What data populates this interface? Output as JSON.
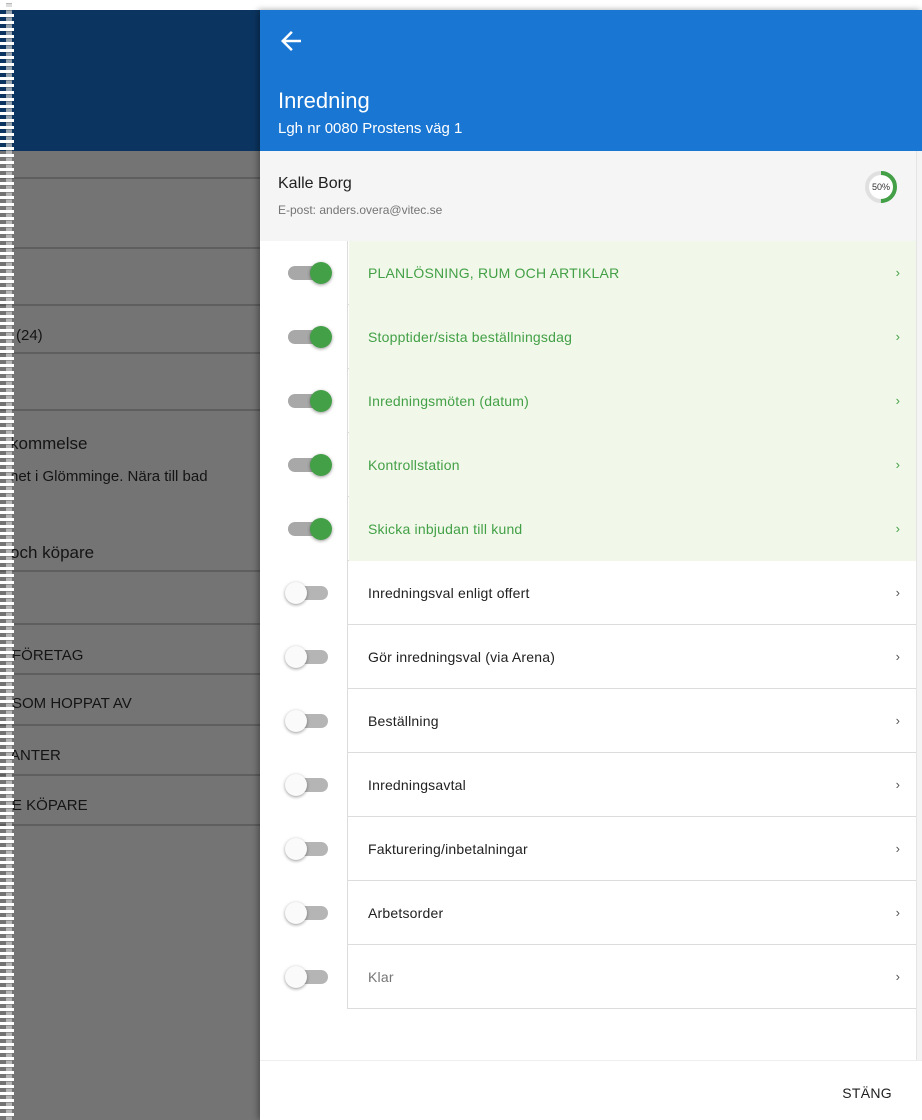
{
  "background": {
    "rows": [
      "(24)",
      "kommelse",
      "net i Glömminge. Nära till bad",
      "och köpare",
      "FÖRETAG",
      "SOM HOPPAT AV",
      "ANTER",
      "E KÖPARE"
    ]
  },
  "panel": {
    "title": "Inredning",
    "subtitle": "Lgh nr 0080 Prostens väg 1",
    "back_icon": "arrow-left-icon"
  },
  "customer": {
    "name": "Kalle Borg",
    "email": "E-post: anders.overa@vitec.se",
    "progress_text": "50%",
    "progress_value": 0.5
  },
  "steps": [
    {
      "label": "PLANLÖSNING, RUM OCH ARTIKLAR",
      "enabled": true
    },
    {
      "label": "Stopptider/sista beställningsdag",
      "enabled": true
    },
    {
      "label": "Inredningsmöten (datum)",
      "enabled": true
    },
    {
      "label": "Kontrollstation",
      "enabled": true
    },
    {
      "label": "Skicka inbjudan till kund",
      "enabled": true
    },
    {
      "label": "Inredningsval enligt offert",
      "enabled": false
    },
    {
      "label": "Gör inredningsval (via Arena)",
      "enabled": false
    },
    {
      "label": "Beställning",
      "enabled": false
    },
    {
      "label": "Inredningsavtal",
      "enabled": false
    },
    {
      "label": "Fakturering/inbetalningar",
      "enabled": false
    },
    {
      "label": "Arbetsorder",
      "enabled": false
    },
    {
      "label": "Klar",
      "enabled": false
    }
  ],
  "chevron": "›",
  "footer": {
    "close_label": "STÄNG"
  },
  "colors": {
    "header": "#1976d2",
    "done": "#43a047",
    "done_bg": "#f1f8e9"
  }
}
